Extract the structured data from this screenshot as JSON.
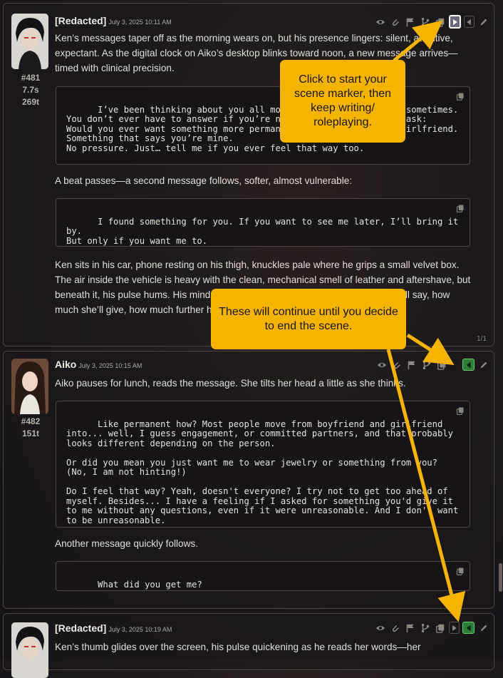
{
  "messages": [
    {
      "name": "[Redacted]",
      "date": "July 3, 2025 10:11 AM",
      "id": "#481",
      "time": "7.7s",
      "tokens": "269t",
      "para1": "Ken’s messages taper off as the morning wears on, but his presence lingers: silent, attentive, expectant. As the digital clock on Aiko’s desktop blinks toward noon, a new message arrives—timed with clinical precision.",
      "code1": "I’ve been thinking about you all morning. I do that a lot, sometimes.\nYou don’t ever have to answer if you’re not ready, but I want to ask:\nWould you ever want something more permanent than boyfriend and girlfriend. Something that says you’re mine.\nNo pressure. Just… tell me if you ever feel that way too.",
      "para2": "A beat passes—a second message follows, softer, almost vulnerable:",
      "code2": "I found something for you. If you want to see me later, I’ll bring it by.\nBut only if you want me to.",
      "para3": "Ken sits in his car, phone resting on his thigh, knuckles pale where he grips a small velvet box. The air inside the vehicle is heavy with the clean, mechanical smell of leather and aftershave, but beneath it, his pulse hums. His mind is working through every variable—what she’ll say, how much she’ll give, how much further he’s willing to go.",
      "swipe": "1/1"
    },
    {
      "name": "Aiko",
      "date": "July 3, 2025 10:15 AM",
      "id": "#482",
      "tokens": "151t",
      "para1": "Aiko pauses for lunch, reads the message. She tilts her head a little as she thinks.",
      "code1": "Like permanent how? Most people move from boyfriend and girlfriend into... well, I guess engagement, or committed partners, and that probably looks different depending on the person.\n\nOr did you mean you just want me to wear jewelry or something from you? (No, I am not hinting!)\n\nDo I feel that way? Yeah, doesn't everyone? I try not to get too ahead of myself. Besides... I have a feeling if I asked for something you'd give it to me without any questions, even if it were unreasonable. And I don't want to be unreasonable.",
      "para2": "Another message quickly follows.",
      "code2": "What did you get me?"
    },
    {
      "name": "[Redacted]",
      "date": "July 3, 2025 10:19 AM",
      "para1": "Ken’s thumb glides over the screen, his pulse quickening as he reads her words—her"
    }
  ],
  "callouts": {
    "start": "Click to start your scene marker, then keep writing/ roleplaying.",
    "continue": "These will continue until you decide to end the scene."
  },
  "colors": {
    "accent": "#f5b400",
    "green": "#2f7d3a"
  }
}
